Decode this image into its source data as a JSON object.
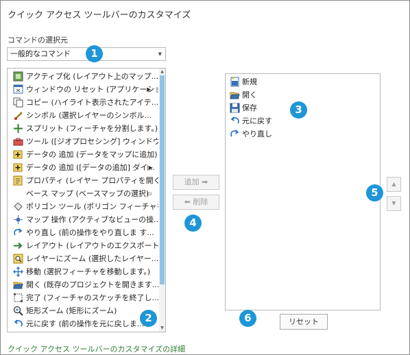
{
  "dialog": {
    "title": "クイック アクセス ツールバーのカスタマイズ"
  },
  "source": {
    "label": "コマンドの選択元",
    "selected": "一般的なコマンド"
  },
  "commands": [
    {
      "label": "アクティブ化 (レイアウト上のマップ...",
      "icon": "map-frame-icon",
      "submenu": ""
    },
    {
      "label": "ウィンドウの リセット (アプリケーショ...",
      "icon": "window-reset-icon",
      "submenu": "▶"
    },
    {
      "label": "コピー (ハイライト表示されたアイテ...",
      "icon": "copy-icon",
      "submenu": ""
    },
    {
      "label": "シンボル (選択レイヤーのシンボル...",
      "icon": "symbol-icon",
      "submenu": ""
    },
    {
      "label": "スプリット (フィーチャを分割します。)",
      "icon": "split-icon",
      "submenu": ""
    },
    {
      "label": "ツール ([ジオプロセシング] ウィンドウ...",
      "icon": "toolbox-icon",
      "submenu": ""
    },
    {
      "label": "データの 追加 (データをマップに追加)",
      "icon": "add-data-icon",
      "submenu": ""
    },
    {
      "label": "データの 追加 ([データの追加] ダイ...",
      "icon": "add-data-icon",
      "submenu": "|▶"
    },
    {
      "label": "プロパティ (レイヤー プロパティを開く)",
      "icon": "properties-icon",
      "submenu": ""
    },
    {
      "label": "ベース マップ (ベースマップの選択)",
      "icon": "",
      "submenu": "▭"
    },
    {
      "label": "ポリゴン ツール (ポリゴン フィーチャを...",
      "icon": "polygon-icon",
      "submenu": ""
    },
    {
      "label": "マップ 操作 (アクティブなビューの操...",
      "icon": "pan-icon",
      "submenu": ""
    },
    {
      "label": "やり直し (前の操作をやり直しま す...",
      "icon": "redo-icon",
      "submenu": ""
    },
    {
      "label": "レイアウト (レイアウトのエクスポート)",
      "icon": "arrow-right-icon",
      "submenu": ""
    },
    {
      "label": "レイヤーにズーム (選択したレイヤー...",
      "icon": "zoom-layer-icon",
      "submenu": ""
    },
    {
      "label": "移動 (選択フィーチャを移動します。)",
      "icon": "move-icon",
      "submenu": ""
    },
    {
      "label": "開く (既存のプロジェクトを開きます...",
      "icon": "open-icon",
      "submenu": ""
    },
    {
      "label": "完了 (フィーチャのスケッチを終了し...",
      "icon": "finish-icon",
      "submenu": ""
    },
    {
      "label": "矩形ズーム (矩形にズーム)",
      "icon": "zoom-icon",
      "submenu": ""
    },
    {
      "label": "元に戻す (前の操作を元に戻しま...",
      "icon": "undo-icon",
      "submenu": ""
    }
  ],
  "buttons": {
    "add": "追加 ➡",
    "remove": "⬅ 削除",
    "reset": "リセット",
    "up": "▲",
    "down": "▼"
  },
  "qat": [
    {
      "label": "新規",
      "icon": "new-project-icon"
    },
    {
      "label": "開く",
      "icon": "open-icon"
    },
    {
      "label": "保存",
      "icon": "save-icon"
    },
    {
      "label": "元に戻す",
      "icon": "undo-icon"
    },
    {
      "label": "やり直し",
      "icon": "redo-icon"
    }
  ],
  "callouts": [
    "1",
    "2",
    "3",
    "4",
    "5",
    "6"
  ],
  "footer": {
    "link": "クイック アクセス ツールバーのカスタマイズの詳細"
  },
  "colors": {
    "callout": "#1e96d8",
    "scroll_thumb": "#8fc4ea",
    "link": "#2e7d32"
  }
}
